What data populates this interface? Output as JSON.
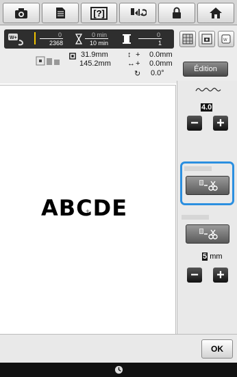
{
  "toolbar": {
    "icons": [
      "camera-icon",
      "document-icon",
      "help-icon",
      "thread-sequence-icon",
      "lock-icon",
      "home-icon"
    ],
    "help_label": "[?]"
  },
  "info": {
    "stitch_current": "0",
    "stitch_total": "2368",
    "time_current": "0 min",
    "time_total": "10 min",
    "color_current": "0",
    "color_total": "1",
    "height_value": "31.9mm",
    "width_value": "145.2mm",
    "vert_offset_sign": "+",
    "vert_offset_value": "0.0mm",
    "horiz_offset_sign": "+",
    "horiz_offset_value": "0.0mm",
    "rotation_value": "0.0°",
    "edit_button": "Édition"
  },
  "canvas": {
    "text": "ABCDE"
  },
  "right_panel": {
    "density_value": "4.0",
    "minus_label": "−",
    "plus_label": "+",
    "distance_value": "5",
    "distance_unit": "mm"
  },
  "footer": {
    "ok_label": "OK"
  },
  "colors": {
    "selection_border": "#2b8fe0",
    "toolbar_bg": "#d6d6d6",
    "panel_bg": "#e9e9e9"
  }
}
